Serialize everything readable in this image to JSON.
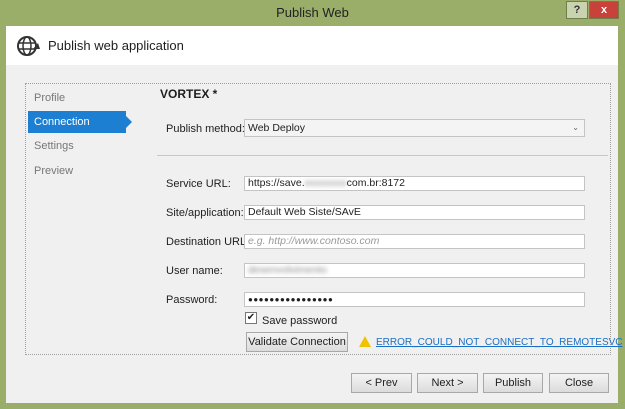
{
  "window": {
    "title": "Publish Web",
    "help_label": "?",
    "close_label": "x"
  },
  "header": {
    "title": "Publish web application"
  },
  "sidebar": {
    "items": [
      {
        "label": "Profile"
      },
      {
        "label": "Connection"
      },
      {
        "label": "Settings"
      },
      {
        "label": "Preview"
      }
    ],
    "active": "Connection"
  },
  "profile_name": "VORTEX *",
  "form": {
    "publish_method": {
      "label": "Publish method:",
      "value": "Web Deploy"
    },
    "service_url": {
      "label": "Service URL:",
      "prefix": "https://save.",
      "hidden": "xxxxxxxx",
      "suffix": "com.br:8172"
    },
    "site": {
      "label": "Site/application:",
      "value": "Default Web Siste/SAvE"
    },
    "destination": {
      "label": "Destination URL:",
      "placeholder": "e.g. http://www.contoso.com"
    },
    "username": {
      "label": "User name:",
      "value": "desenvolvimento"
    },
    "password": {
      "label": "Password:",
      "value": "●●●●●●●●●●●●●●●●"
    },
    "save_password": {
      "label": "Save password",
      "checked": true
    },
    "validate_label": "Validate Connection",
    "error_text": "ERROR_COULD_NOT_CONNECT_TO_REMOTESVC"
  },
  "footer": {
    "prev": "< Prev",
    "next": "Next >",
    "publish": "Publish",
    "close": "Close"
  },
  "colors": {
    "frame": "#9aae69",
    "accent": "#1c7fd1",
    "link": "#1a6fc4"
  }
}
